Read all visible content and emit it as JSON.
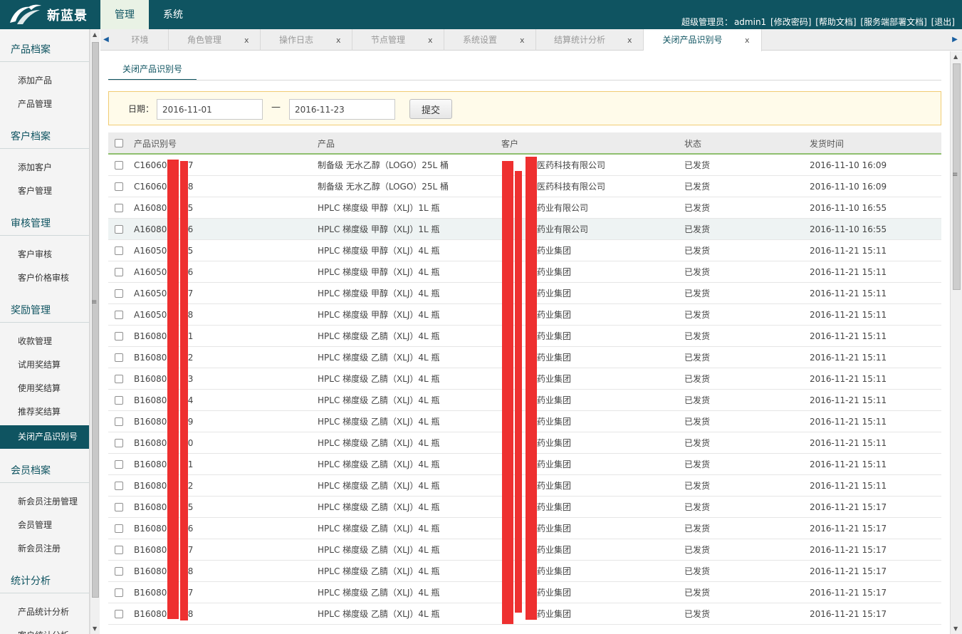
{
  "header": {
    "logo_text": "新蓝景",
    "menu": [
      {
        "label": "管理",
        "active": true
      },
      {
        "label": "系统",
        "active": false
      }
    ],
    "user_prefix": "超级管理员：",
    "user_name": "admin1",
    "links": [
      "[修改密码]",
      "[帮助文档]",
      "[服务端部署文档]",
      "[退出]"
    ]
  },
  "sidebar": {
    "sections": [
      {
        "title": "产品档案",
        "items": [
          "添加产品",
          "产品管理"
        ]
      },
      {
        "title": "客户档案",
        "items": [
          "添加客户",
          "客户管理"
        ]
      },
      {
        "title": "审核管理",
        "items": [
          "客户审核",
          "客户价格审核"
        ]
      },
      {
        "title": "奖励管理",
        "items": [
          "收款管理",
          "试用奖结算",
          "使用奖结算",
          "推荐奖结算",
          "关闭产品识别号"
        ]
      },
      {
        "title": "会员档案",
        "items": [
          "新会员注册管理",
          "会员管理",
          "新会员注册"
        ]
      },
      {
        "title": "统计分析",
        "items": [
          "产品统计分析",
          "客户统计分析"
        ]
      }
    ],
    "active_item": "关闭产品识别号"
  },
  "tabs": [
    {
      "label": "环境",
      "closable": false
    },
    {
      "label": "角色管理",
      "closable": true
    },
    {
      "label": "操作日志",
      "closable": true
    },
    {
      "label": "节点管理",
      "closable": true
    },
    {
      "label": "系统设置",
      "closable": true
    },
    {
      "label": "结算统计分析",
      "closable": true
    },
    {
      "label": "关闭产品识别号",
      "closable": true,
      "active": true
    }
  ],
  "tab_close_glyph": "x",
  "subtab": "关闭产品识别号",
  "filter": {
    "label": "日期：",
    "from": "2016-11-01",
    "to": "2016-11-23",
    "dash": "—",
    "submit": "提交"
  },
  "table": {
    "columns": [
      "产品识别号",
      "产品",
      "客户",
      "状态",
      "发货时间"
    ],
    "rows": [
      {
        "code": "C1606000",
        "code_tail": "7",
        "product": "制备级 无水乙醇（LOGO）25L 桶",
        "cust_pre": "",
        "customer": "医药科技有限公司",
        "status": "已发货",
        "time": "2016-11-10 16:09"
      },
      {
        "code": "C1606000",
        "code_tail": "8",
        "product": "制备级 无水乙醇（LOGO）25L 桶",
        "cust_pre": "",
        "customer": "医药科技有限公司",
        "status": "已发货",
        "time": "2016-11-10 16:09"
      },
      {
        "code": "A1608007",
        "code_tail": "5",
        "product": "HPLC 梯度级 甲醇（XLJ）1L 瓶",
        "cust_pre": "",
        "customer": "药业有限公司",
        "status": "已发货",
        "time": "2016-11-10 16:55"
      },
      {
        "code": "A1608007",
        "code_tail": "6",
        "product": "HPLC 梯度级 甲醇（XLJ）1L 瓶",
        "cust_pre": "",
        "customer": "药业有限公司",
        "status": "已发货",
        "time": "2016-11-10 16:55"
      },
      {
        "code": "A1605000",
        "code_tail": "5",
        "product": "HPLC 梯度级 甲醇（XLJ）4L 瓶",
        "cust_pre": "",
        "customer": "药业集团",
        "status": "已发货",
        "time": "2016-11-21 15:11"
      },
      {
        "code": "A1605000",
        "code_tail": "6",
        "product": "HPLC 梯度级 甲醇（XLJ）4L 瓶",
        "cust_pre": "",
        "customer": "药业集团",
        "status": "已发货",
        "time": "2016-11-21 15:11"
      },
      {
        "code": "A1605000",
        "code_tail": "7",
        "product": "HPLC 梯度级 甲醇（XLJ）4L 瓶",
        "cust_pre": "",
        "customer": "药业集团",
        "status": "已发货",
        "time": "2016-11-21 15:11"
      },
      {
        "code": "A1605000",
        "code_tail": "8",
        "product": "HPLC 梯度级 甲醇（XLJ）4L 瓶",
        "cust_pre": "",
        "customer": "药业集团",
        "status": "已发货",
        "time": "2016-11-21 15:11"
      },
      {
        "code": "B1608005",
        "code_tail": "1",
        "product": "HPLC 梯度级 乙腈（XLJ）4L 瓶",
        "cust_pre": "",
        "customer": "药业集团",
        "status": "已发货",
        "time": "2016-11-21 15:11"
      },
      {
        "code": "B1608005",
        "code_tail": "2",
        "product": "HPLC 梯度级 乙腈（XLJ）4L 瓶",
        "cust_pre": "",
        "customer": "药业集团",
        "status": "已发货",
        "time": "2016-11-21 15:11"
      },
      {
        "code": "B1608005",
        "code_tail": "3",
        "product": "HPLC 梯度级 乙腈（XLJ）4L 瓶",
        "cust_pre": "",
        "customer": "药业集团",
        "status": "已发货",
        "time": "2016-11-21 15:11"
      },
      {
        "code": "B1608005",
        "code_tail": "4",
        "product": "HPLC 梯度级 乙腈（XLJ）4L 瓶",
        "cust_pre": "",
        "customer": "药业集团",
        "status": "已发货",
        "time": "2016-11-21 15:11"
      },
      {
        "code": "B1608005",
        "code_tail": "9",
        "product": "HPLC 梯度级 乙腈（XLJ）4L 瓶",
        "cust_pre": "",
        "customer": "药业集团",
        "status": "已发货",
        "time": "2016-11-21 15:11"
      },
      {
        "code": "B1608005",
        "code_tail": "0",
        "product": "HPLC 梯度级 乙腈（XLJ）4L 瓶",
        "cust_pre": "",
        "customer": "药业集团",
        "status": "已发货",
        "time": "2016-11-21 15:11"
      },
      {
        "code": "B1608005",
        "code_tail": "1",
        "product": "HPLC 梯度级 乙腈（XLJ）4L 瓶",
        "cust_pre": "",
        "customer": "药业集团",
        "status": "已发货",
        "time": "2016-11-21 15:11"
      },
      {
        "code": "B1608005",
        "code_tail": "2",
        "product": "HPLC 梯度级 乙腈（XLJ）4L 瓶",
        "cust_pre": "",
        "customer": "药业集团",
        "status": "已发货",
        "time": "2016-11-21 15:11"
      },
      {
        "code": "B1608005",
        "code_tail": "5",
        "product": "HPLC 梯度级 乙腈（XLJ）4L 瓶",
        "cust_pre": "",
        "customer": "药业集团",
        "status": "已发货",
        "time": "2016-11-21 15:17"
      },
      {
        "code": "B1608005",
        "code_tail": "6",
        "product": "HPLC 梯度级 乙腈（XLJ）4L 瓶",
        "cust_pre": "",
        "customer": "药业集团",
        "status": "已发货",
        "time": "2016-11-21 15:17"
      },
      {
        "code": "B1608005",
        "code_tail": "7",
        "product": "HPLC 梯度级 乙腈（XLJ）4L 瓶",
        "cust_pre": "",
        "customer": "药业集团",
        "status": "已发货",
        "time": "2016-11-21 15:17"
      },
      {
        "code": "B1608005",
        "code_tail": "8",
        "product": "HPLC 梯度级 乙腈（XLJ）4L 瓶",
        "cust_pre": "",
        "customer": "药业集团",
        "status": "已发货",
        "time": "2016-11-21 15:17"
      },
      {
        "code": "B1608007",
        "code_tail": "7",
        "product": "HPLC 梯度级 乙腈（XLJ）4L 瓶",
        "cust_pre": "",
        "customer": "药业集团",
        "status": "已发货",
        "time": "2016-11-21 15:17"
      },
      {
        "code": "B1608007",
        "code_tail": "8",
        "product": "HPLC 梯度级 乙腈（XLJ）4L 瓶",
        "cust_pre": "",
        "customer": "药业集团",
        "status": "已发货",
        "time": "2016-11-21 15:17"
      }
    ],
    "highlighted_row": 3
  },
  "colors": {
    "header_bg": "#0f5461",
    "active_menu_bg": "#e9f2e5",
    "redaction": "#ee3030",
    "filter_bg": "#fffbea",
    "filter_border": "#f1cc74"
  }
}
